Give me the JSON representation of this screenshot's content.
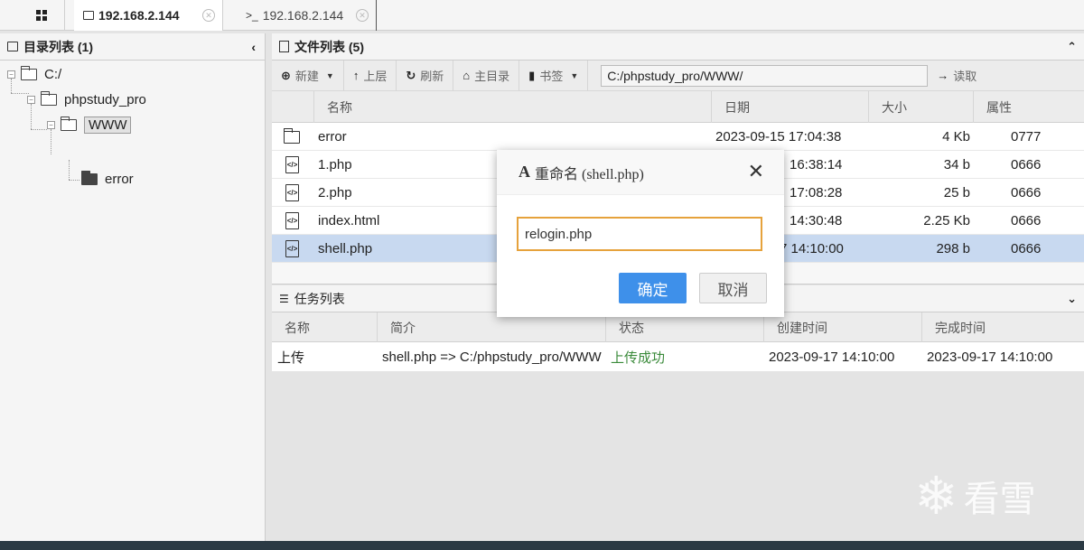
{
  "tabs": [
    {
      "label": "192.168.2.144",
      "active": true,
      "icon": "folder-icon"
    },
    {
      "label": "192.168.2.144",
      "active": false,
      "icon": "terminal-icon"
    }
  ],
  "left_panel": {
    "title": "目录列表 (1)",
    "tree": {
      "root": "C:/",
      "level1": "phpstudy_pro",
      "level2": "WWW",
      "level3": "error"
    }
  },
  "file_panel": {
    "title": "文件列表 (5)",
    "toolbar": {
      "new": "新建",
      "up": "上层",
      "refresh": "刷新",
      "home": "主目录",
      "bookmark": "书签",
      "path": "C:/phpstudy_pro/WWW/",
      "read": "读取"
    },
    "columns": [
      "名称",
      "日期",
      "大小",
      "属性"
    ],
    "files": [
      {
        "name": "error",
        "date": "2023-09-15 17:04:38",
        "size": "4 Kb",
        "perm": "0777",
        "type": "folder"
      },
      {
        "name": "1.php",
        "date": "16:38:14",
        "size": "34 b",
        "perm": "0666",
        "type": "code"
      },
      {
        "name": "2.php",
        "date": "17:08:28",
        "size": "25 b",
        "perm": "0666",
        "type": "code"
      },
      {
        "name": "index.html",
        "date": "14:30:48",
        "size": "2.25 Kb",
        "perm": "0666",
        "type": "code"
      },
      {
        "name": "shell.php",
        "date": "7 14:10:00",
        "size": "298 b",
        "perm": "0666",
        "type": "code",
        "selected": true
      }
    ]
  },
  "task_panel": {
    "title": "任务列表",
    "columns": [
      "名称",
      "简介",
      "状态",
      "创建时间",
      "完成时间"
    ],
    "rows": [
      {
        "name": "上传",
        "desc": "shell.php => C:/phpstudy_pro/WWW",
        "status": "上传成功",
        "created": "2023-09-17 14:10:00",
        "finished": "2023-09-17 14:10:00"
      }
    ]
  },
  "modal": {
    "title": "重命名 (shell.php)",
    "icon_letter": "A",
    "input_value": "relogin.php",
    "ok": "确定",
    "cancel": "取消"
  },
  "watermark": "看雪",
  "colors": {
    "primary": "#3e90ea",
    "input_focus": "#e6a23c",
    "success": "#3a8a3a",
    "selected_row": "#c8d9f0"
  }
}
